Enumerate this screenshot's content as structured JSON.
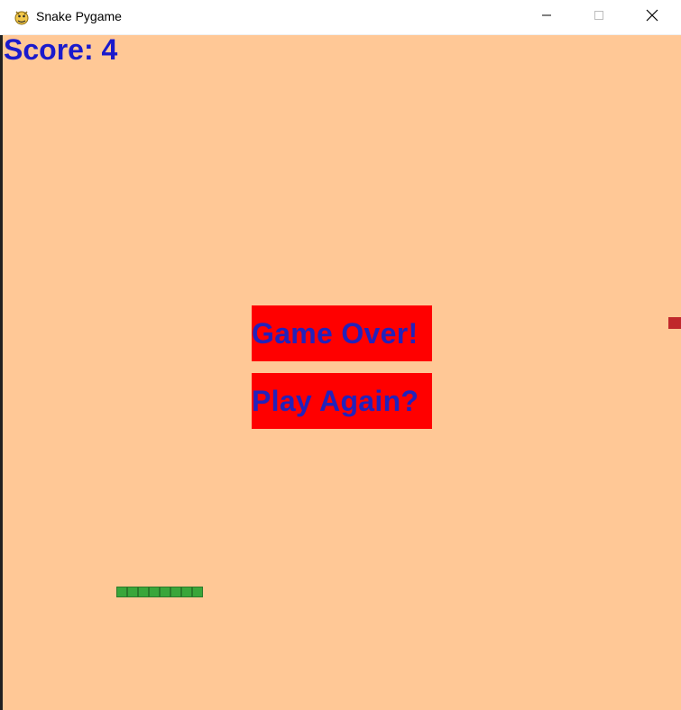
{
  "window": {
    "title": "Snake Pygame",
    "icons": {
      "app": "pygame-snake-icon",
      "minimize": "minimize-icon",
      "maximize": "maximize-icon",
      "close": "close-icon"
    }
  },
  "game": {
    "score_text": "Score: 4",
    "game_over_text": "Game Over!",
    "play_again_text": "Play Again?",
    "snake_length": 8,
    "colors": {
      "background": "#ffc896",
      "text": "#1a1acc",
      "message_box": "#ff0000",
      "snake": "#3aa63a",
      "food": "#c0282b"
    }
  }
}
